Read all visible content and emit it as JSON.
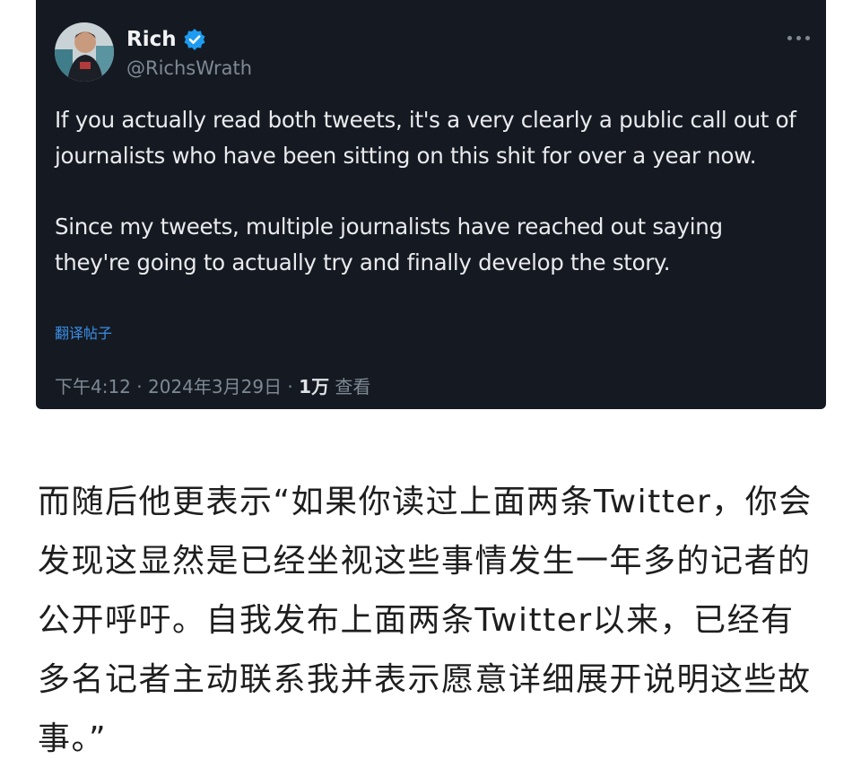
{
  "tweet": {
    "display_name": "Rich",
    "handle": "@RichsWrath",
    "paragraphs": [
      "If you actually read both tweets, it's a very clearly a public call out of journalists who have been sitting on this shit for over a year now.",
      "Since my tweets, multiple journalists have reached out saying they're going to actually try and finally develop the story."
    ],
    "translate_label": "翻译帖子",
    "time": "下午4:12",
    "date": "2024年3月29日",
    "separator": " · ",
    "views_count": "1万",
    "views_label": " 查看",
    "icons": {
      "verified": "verified-badge-icon",
      "more": "more-icon"
    },
    "colors": {
      "background": "#151a22",
      "verified": "#1d9bf0",
      "link": "#3a8ee6"
    }
  },
  "article": {
    "text": "而随后他更表示“如果你读过上面两条Twitter，你会发现这显然是已经坐视这些事情发生一年多的记者的公开呼吁。自我发布上面两条Twitter以来，已经有多名记者主动联系我并表示愿意详细展开说明这些故事。”"
  }
}
